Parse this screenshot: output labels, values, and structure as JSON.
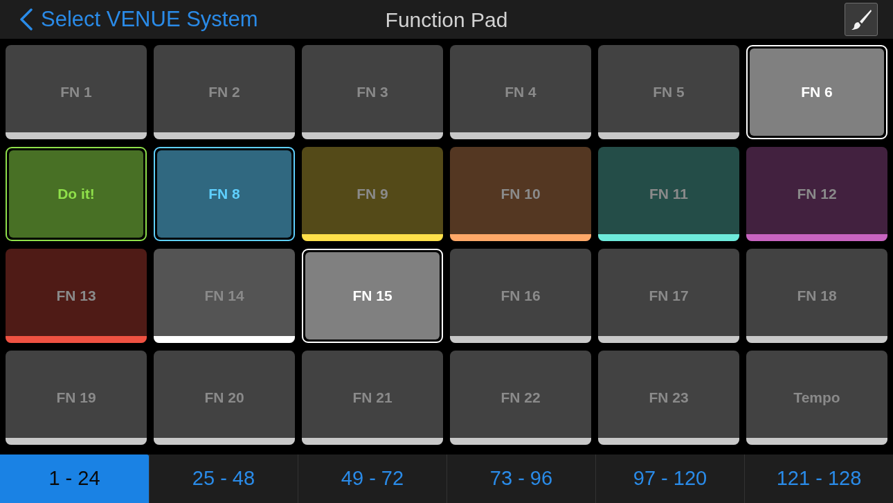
{
  "header": {
    "back_label": "Select VENUE System",
    "title": "Function Pad"
  },
  "pads": [
    {
      "label": "FN 1",
      "color": "#c8c8c8",
      "on": false
    },
    {
      "label": "FN 2",
      "color": "#c8c8c8",
      "on": false
    },
    {
      "label": "FN 3",
      "color": "#c8c8c8",
      "on": false
    },
    {
      "label": "FN 4",
      "color": "#c8c8c8",
      "on": false
    },
    {
      "label": "FN 5",
      "color": "#c8c8c8",
      "on": false
    },
    {
      "label": "FN 6",
      "color": "#ffffff",
      "on": true
    },
    {
      "label": "Do it!",
      "color": "#8fe04a",
      "on": true
    },
    {
      "label": "FN 8",
      "color": "#5fd0ff",
      "on": true
    },
    {
      "label": "FN 9",
      "color": "#ffe04a",
      "on": false
    },
    {
      "label": "FN 10",
      "color": "#ffa868",
      "on": false
    },
    {
      "label": "FN 11",
      "color": "#6eeadb",
      "on": false
    },
    {
      "label": "FN 12",
      "color": "#c864c0",
      "on": false
    },
    {
      "label": "FN 13",
      "color": "#ef5242",
      "on": false
    },
    {
      "label": "FN 14",
      "color": "#ffffff",
      "on": false
    },
    {
      "label": "FN 15",
      "color": "#ffffff",
      "on": true
    },
    {
      "label": "FN 16",
      "color": "#c8c8c8",
      "on": false
    },
    {
      "label": "FN 17",
      "color": "#c8c8c8",
      "on": false
    },
    {
      "label": "FN 18",
      "color": "#c8c8c8",
      "on": false
    },
    {
      "label": "FN 19",
      "color": "#c8c8c8",
      "on": false
    },
    {
      "label": "FN 20",
      "color": "#c8c8c8",
      "on": false
    },
    {
      "label": "FN 21",
      "color": "#c8c8c8",
      "on": false
    },
    {
      "label": "FN 22",
      "color": "#c8c8c8",
      "on": false
    },
    {
      "label": "FN 23",
      "color": "#c8c8c8",
      "on": false
    },
    {
      "label": "Tempo",
      "color": "#c8c8c8",
      "on": false
    }
  ],
  "bank_tabs": [
    {
      "label": "1 - 24",
      "selected": true
    },
    {
      "label": "25 - 48",
      "selected": false
    },
    {
      "label": "49 - 72",
      "selected": false
    },
    {
      "label": "73 - 96",
      "selected": false
    },
    {
      "label": "97 - 120",
      "selected": false
    },
    {
      "label": "121 - 128",
      "selected": false
    }
  ]
}
